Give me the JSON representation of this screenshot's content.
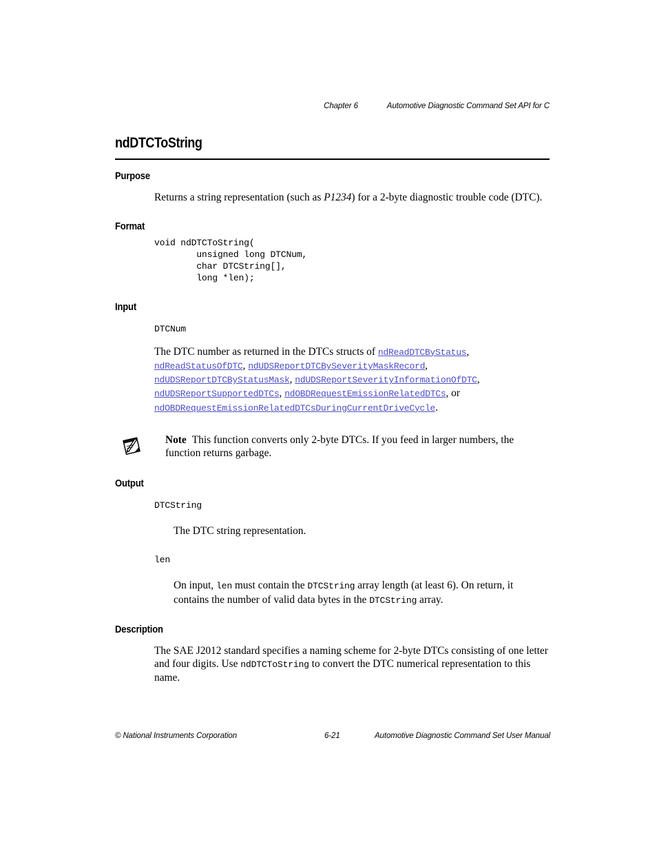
{
  "header": {
    "chapter_label": "Chapter 6",
    "chapter_title": "Automotive Diagnostic Command Set API for C"
  },
  "title": "ndDTCToString",
  "sections": {
    "purpose": {
      "heading": "Purpose",
      "text_before": "Returns a string representation (such as ",
      "italic_example": "P1234",
      "text_after": ") for a 2-byte diagnostic trouble code (DTC)."
    },
    "format": {
      "heading": "Format",
      "code": "void ndDTCToString(\n        unsigned long DTCNum,\n        char DTCString[],\n        long *len);"
    },
    "input": {
      "heading": "Input",
      "param_name": "DTCNum",
      "description_lead": "The DTC number as returned in the DTCs structs of ",
      "links": [
        "ndReadDTCByStatus",
        "ndReadStatusOfDTC",
        "ndUDSReportDTCBySeverityMaskRecord",
        "ndUDSReportDTCByStatusMask",
        "ndUDSReportSeverityInformationOfDTC",
        "ndUDSReportSupportedDTCs",
        "ndOBDRequestEmissionRelatedDTCs",
        "ndOBDRequestEmissionRelatedDTCsDuringCurrentDriveCycle"
      ],
      "conjunction": "or",
      "terminator": "."
    },
    "note": {
      "icon": "note-pencil-notepad-icon",
      "label": "Note",
      "text": "This function converts only 2-byte DTCs. If you feed in larger numbers, the function returns garbage."
    },
    "output": {
      "heading": "Output",
      "params": [
        {
          "name": "DTCString",
          "description": "The DTC string representation."
        },
        {
          "name": "len",
          "desc_part_1": "On input, ",
          "desc_mono_1": "len",
          "desc_part_2": " must contain the ",
          "desc_mono_2": "DTCString",
          "desc_part_3": " array length (at least 6). On return, it contains the number of valid data bytes in the ",
          "desc_mono_3": "DTCString",
          "desc_part_4": " array."
        }
      ]
    },
    "description": {
      "heading": "Description",
      "text_part_1": "The SAE J2012 standard specifies a naming scheme for 2-byte DTCs consisting of one letter and four digits. Use ",
      "mono_1": "ndDTCToString",
      "text_part_2": " to convert the DTC numerical representation to this name."
    }
  },
  "footer": {
    "copyright": "© National Instruments Corporation",
    "page_number": "6-21",
    "manual_title": "Automotive Diagnostic Command Set User Manual"
  },
  "colors": {
    "link": "#4e4ec4",
    "text": "#000000",
    "background": "#ffffff"
  }
}
